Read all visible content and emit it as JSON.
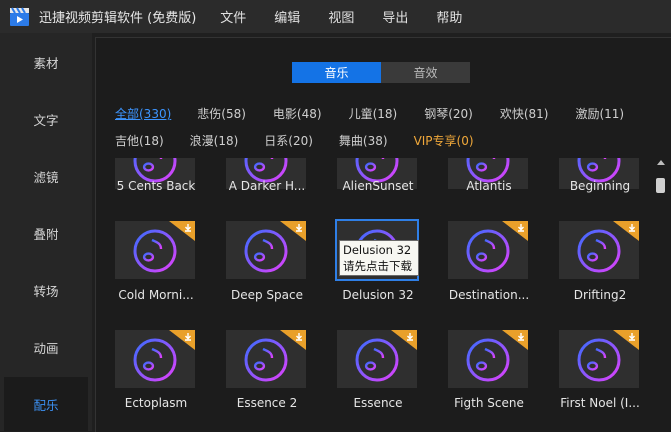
{
  "window": {
    "title": "迅捷视频剪辑软件 (免费版)"
  },
  "menu": [
    "文件",
    "编辑",
    "视图",
    "导出",
    "帮助"
  ],
  "sidebar": {
    "items": [
      {
        "label": "素材"
      },
      {
        "label": "文字"
      },
      {
        "label": "滤镜"
      },
      {
        "label": "叠附"
      },
      {
        "label": "转场"
      },
      {
        "label": "动画"
      },
      {
        "label": "配乐",
        "active": true
      }
    ]
  },
  "tabs": {
    "music": "音乐",
    "effects": "音效",
    "selected": "音乐"
  },
  "categories": {
    "row1": [
      "全部(330)",
      "悲伤(58)",
      "电影(48)",
      "儿童(18)",
      "钢琴(20)",
      "欢快(81)",
      "激励(11)"
    ],
    "row2": [
      "吉他(18)",
      "浪漫(18)",
      "日系(20)",
      "舞曲(38)",
      "VIP专享(0)"
    ],
    "selected": "全部(330)"
  },
  "tracks": [
    [
      "5 Cents Back",
      "A Darker H...",
      "AlienSunset",
      "Atlantis",
      "Beginning"
    ],
    [
      "Cold Morni...",
      "Deep Space",
      "Delusion 32",
      "Destination...",
      "Drifting2"
    ],
    [
      "Ectoplasm",
      "Essence 2",
      "Essence",
      "Figth Scene",
      "First Noel (I..."
    ]
  ],
  "tooltip": {
    "title": "Delusion 32",
    "hint": "请先点击下载"
  },
  "colors": {
    "accent": "#1473e6",
    "vip": "#f0a83a",
    "badge": "#e9a02a",
    "note_start": "#3a6cff",
    "note_end": "#e040fb"
  },
  "icons": {
    "download": "download-icon",
    "music_note": "music-note-icon",
    "logo": "film-clapper-icon"
  }
}
